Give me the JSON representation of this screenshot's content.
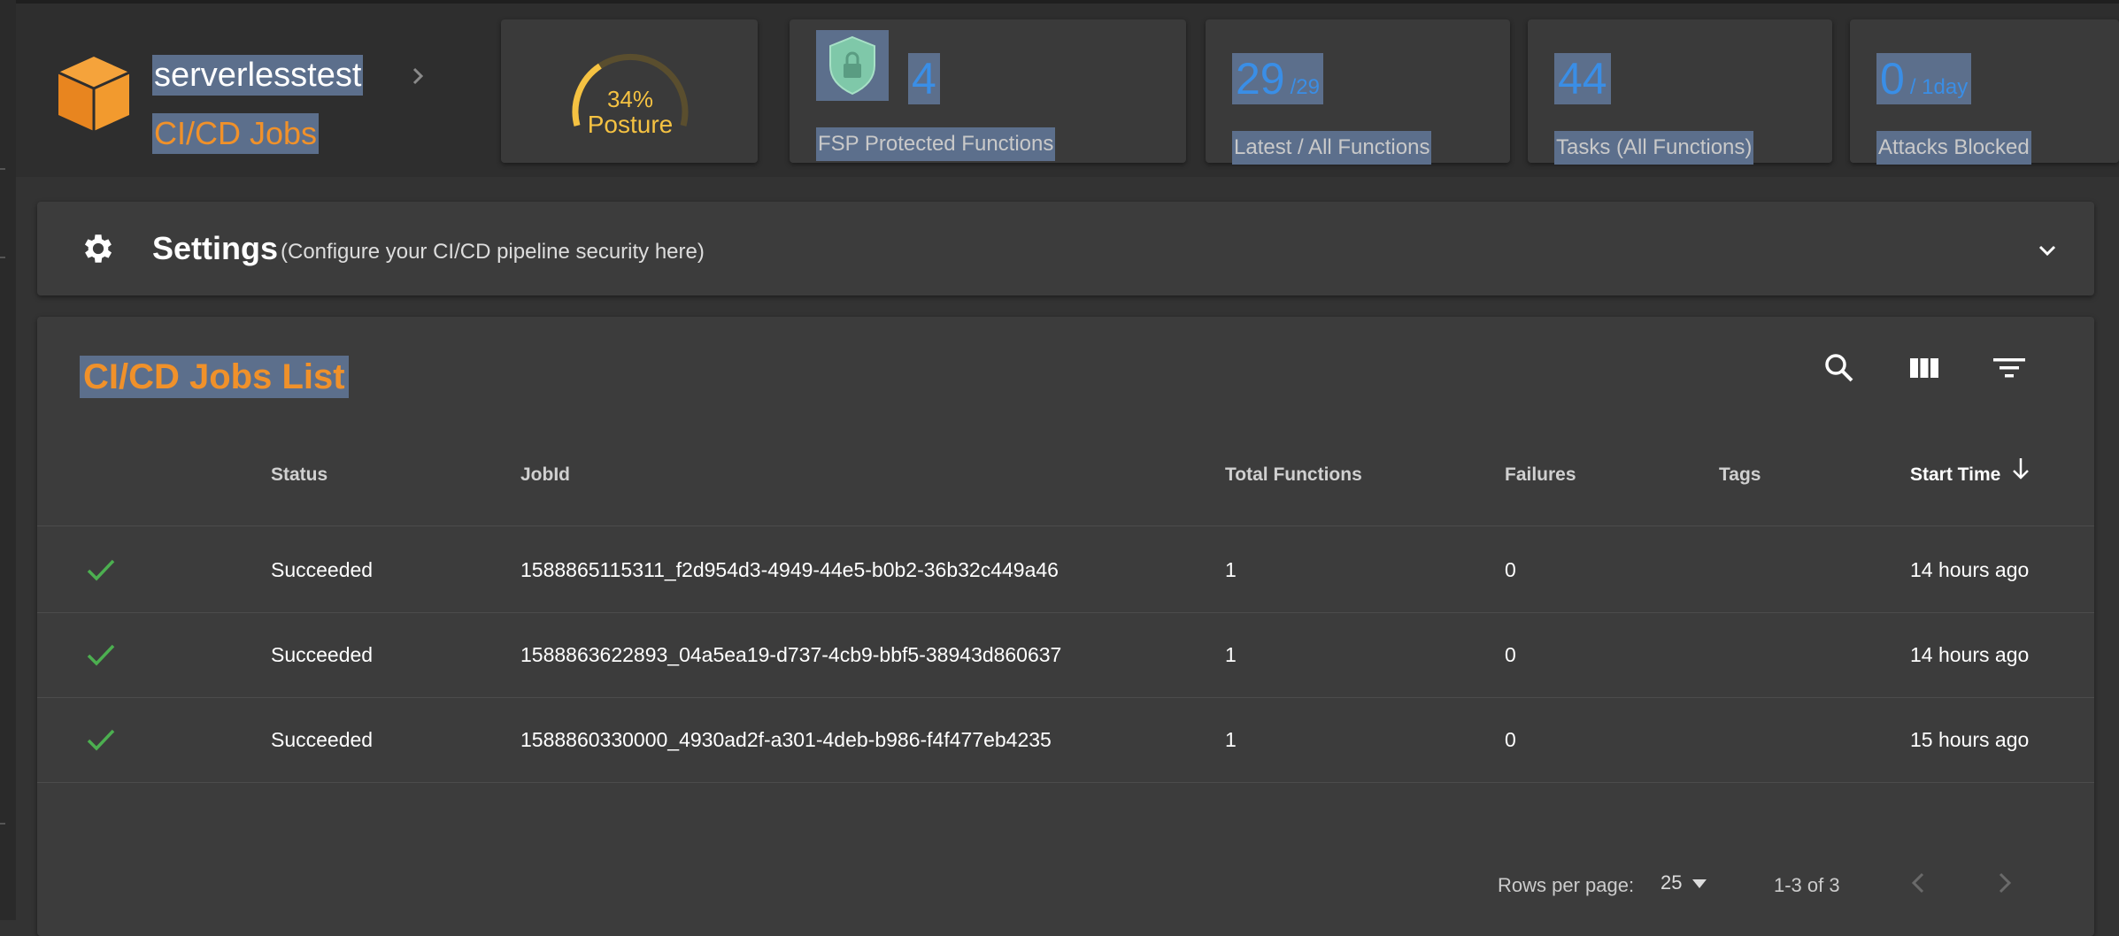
{
  "header": {
    "project_name": "serverlesstest",
    "page_subtitle": "CI/CD Jobs",
    "posture": {
      "value_text": "34%",
      "label": "Posture",
      "fraction": 0.34
    },
    "fsp": {
      "count": "4",
      "label": "FSP Protected Functions"
    },
    "latest": {
      "value": "29",
      "unit": "/29",
      "label": "Latest / All Functions"
    },
    "tasks": {
      "value": "44",
      "label": "Tasks (All Functions)"
    },
    "attacks": {
      "value": "0",
      "unit": "/ 1day",
      "label": "Attacks Blocked"
    }
  },
  "settings": {
    "title": "Settings",
    "description": "(Configure your CI/CD pipeline security here)"
  },
  "jobs": {
    "title": "CI/CD Jobs List",
    "columns": {
      "status": "Status",
      "jobid": "JobId",
      "total": "Total Functions",
      "failures": "Failures",
      "tags": "Tags",
      "start": "Start Time"
    },
    "rows": [
      {
        "status": "Succeeded",
        "jobid": "1588865115311_f2d954d3-4949-44e5-b0b2-36b32c449a46",
        "total": "1",
        "failures": "0",
        "tags": "",
        "start": "14 hours ago"
      },
      {
        "status": "Succeeded",
        "jobid": "1588863622893_04a5ea19-d737-4cb9-bbf5-38943d860637",
        "total": "1",
        "failures": "0",
        "tags": "",
        "start": "14 hours ago"
      },
      {
        "status": "Succeeded",
        "jobid": "1588860330000_4930ad2f-a301-4deb-b986-f4f477eb4235",
        "total": "1",
        "failures": "0",
        "tags": "",
        "start": "15 hours ago"
      }
    ],
    "pagination": {
      "rows_per_page_label": "Rows per page:",
      "rows_per_page": "25",
      "range": "1-3 of 3"
    }
  },
  "colors": {
    "accent_orange": "#f0912a",
    "metric_blue": "#3a8ee6",
    "gauge_yellow": "#f5c242",
    "success_green": "#4caf50",
    "selection": "#5c6f8c"
  },
  "icons": [
    "aws-cube-icon",
    "chevron-right-icon",
    "shield-lock-icon",
    "gear-icon",
    "chevron-down-icon",
    "search-icon",
    "view-columns-icon",
    "filter-list-icon",
    "arrow-down-icon",
    "check-icon",
    "caret-down-icon",
    "chevron-left-icon"
  ]
}
